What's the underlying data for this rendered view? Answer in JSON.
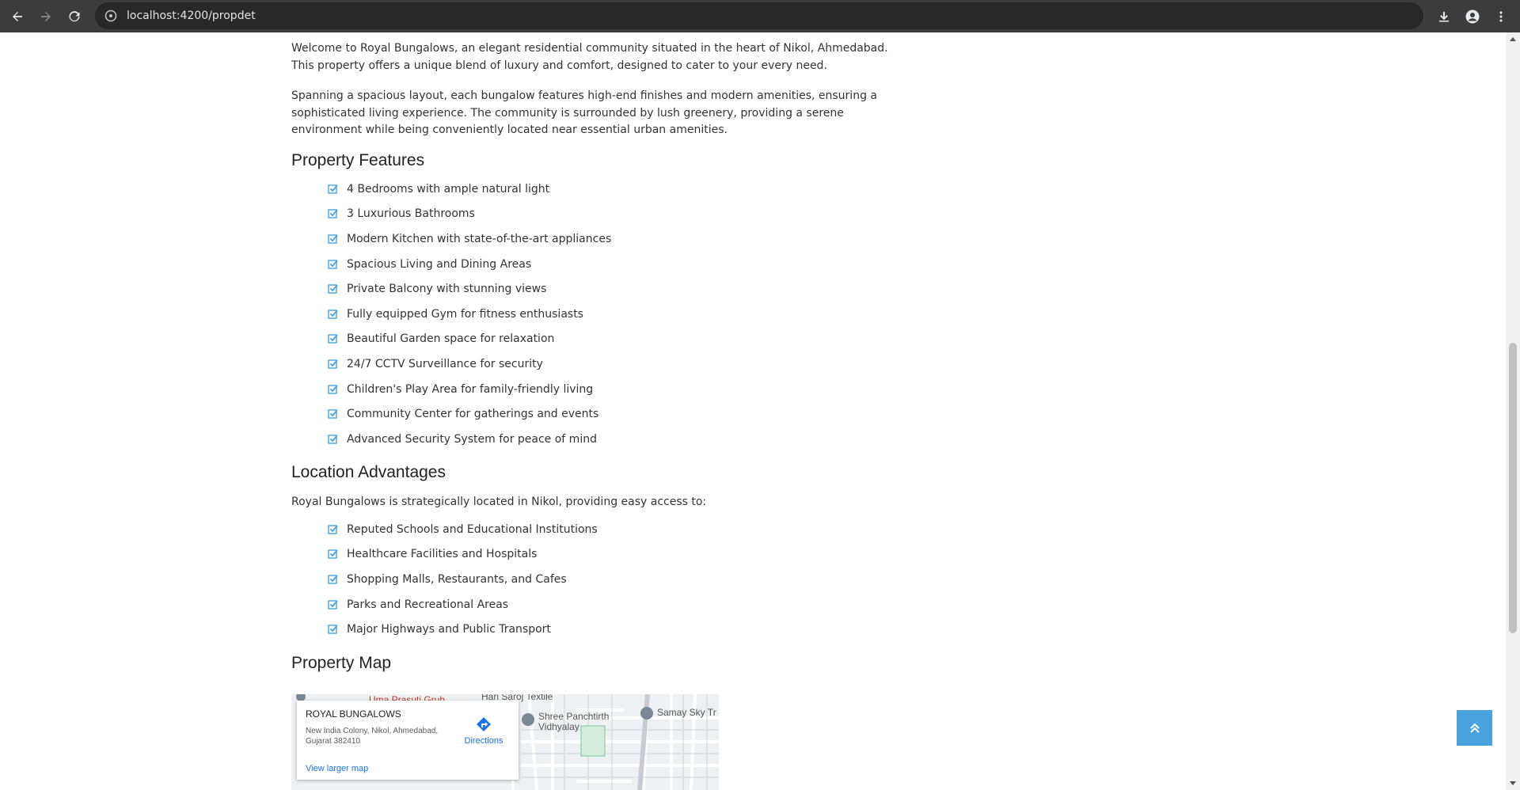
{
  "browser": {
    "url": "localhost:4200/propdet"
  },
  "content": {
    "intro_paragraph": "Welcome to Royal Bungalows, an elegant residential community situated in the heart of Nikol, Ahmedabad. This property offers a unique blend of luxury and comfort, designed to cater to your every need.",
    "second_paragraph": "Spanning a spacious layout, each bungalow features high-end finishes and modern amenities, ensuring a sophisticated living experience. The community is surrounded by lush greenery, providing a serene environment while being conveniently located near essential urban amenities.",
    "features_heading": "Property Features",
    "features": [
      "4 Bedrooms with ample natural light",
      "3 Luxurious Bathrooms",
      "Modern Kitchen with state-of-the-art appliances",
      "Spacious Living and Dining Areas",
      "Private Balcony with stunning views",
      "Fully equipped Gym for fitness enthusiasts",
      "Beautiful Garden space for relaxation",
      "24/7 CCTV Surveillance for security",
      "Children's Play Area for family-friendly living",
      "Community Center for gatherings and events",
      "Advanced Security System for peace of mind"
    ],
    "location_heading": "Location Advantages",
    "location_intro": "Royal Bungalows is strategically located in Nikol, providing easy access to:",
    "location_items": [
      "Reputed Schools and Educational Institutions",
      "Healthcare Facilities and Hospitals",
      "Shopping Malls, Restaurants, and Cafes",
      "Parks and Recreational Areas",
      "Major Highways and Public Transport"
    ],
    "map_heading": "Property Map"
  },
  "map": {
    "place_name": "ROYAL BUNGALOWS",
    "address": "New India Colony, Nikol, Ahmedabad, Gujarat 382410",
    "directions_label": "Directions",
    "larger_map_label": "View larger map",
    "labels": {
      "uma": "Uma Prasuti Gruh",
      "hari": "Hari Saroj Textile",
      "panchtirth": "Shree Panchtirth Vidhyalay",
      "samay": "Samay Sky Tr"
    }
  },
  "colors": {
    "check_icon": "#4aa3df",
    "back_to_top": "#4aa3df",
    "link": "#1a73e8"
  }
}
